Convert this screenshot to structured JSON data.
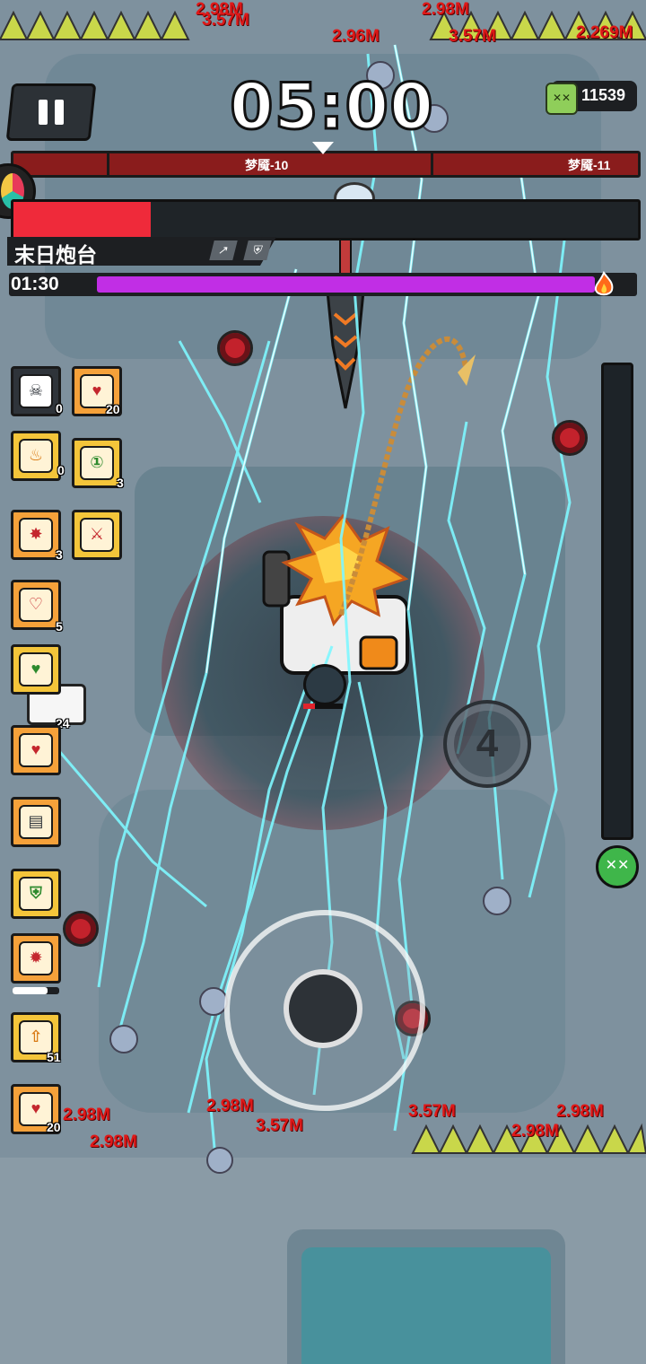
{
  "hud": {
    "timer": "05:00",
    "coin_count": "11539",
    "pause_icon": "pause-icon",
    "coin_icon": "slime-coin-icon"
  },
  "wave": {
    "current_label": "梦魇-10",
    "next_label": "梦魇-11"
  },
  "boss": {
    "name": "末日炮台",
    "hp_fraction": 0.22,
    "rage_timer": "01:30",
    "rage_fraction": 0.94
  },
  "skills": [
    {
      "icon": "skull-chain-icon",
      "count": "0",
      "style": "dark"
    },
    {
      "icon": "heart-bandage-icon",
      "count": "20",
      "style": "orange"
    },
    {
      "icon": "flame-hood-icon",
      "count": "0",
      "style": "yellow"
    },
    {
      "icon": "coin-one-icon",
      "count": "3",
      "style": "yellow"
    },
    {
      "icon": "explosion-card-icon",
      "count": "3",
      "style": "orange"
    },
    {
      "icon": "sword-icon",
      "count": "",
      "style": "yellow"
    },
    {
      "icon": "heart-card-icon",
      "count": "5",
      "style": "orange"
    },
    {
      "icon": "heart-shield-icon",
      "count": "",
      "style": "yellow"
    },
    {
      "icon": "heart-icon",
      "count": "",
      "style": "orange"
    },
    {
      "icon": "battery-icon",
      "count": "",
      "style": "orange"
    },
    {
      "icon": "shield-one-icon",
      "count": "",
      "style": "yellow"
    },
    {
      "icon": "burst-eye-icon",
      "count": "",
      "style": "orange"
    },
    {
      "icon": "up-arrow-icon",
      "count": "51",
      "style": "orange"
    },
    {
      "icon": "heart-bandage-icon",
      "count": "20",
      "style": "orange"
    }
  ],
  "player_weapon_count": "24",
  "damage_numbers": [
    "2.98M",
    "3.57M",
    "2.96M",
    "2.269M",
    "2.98M",
    "3.57M",
    "2.98M",
    "2.98M",
    "3.57M",
    "2.98M",
    "3.57M",
    "2.98M",
    "2.98M"
  ],
  "colors": {
    "boss_hp": "#ef2a3a",
    "rage": "#c12ee5",
    "wave": "#8a1c1c",
    "skill_yellow": "#f4c53a",
    "skill_orange": "#f5a13a",
    "lightning": "#7ff7ff",
    "damage_text": "#e01818"
  },
  "controls": {
    "joystick_icon": "joystick-icon",
    "skill_button_label": "4",
    "gauge_cap_icon": "slime-face-icon"
  }
}
